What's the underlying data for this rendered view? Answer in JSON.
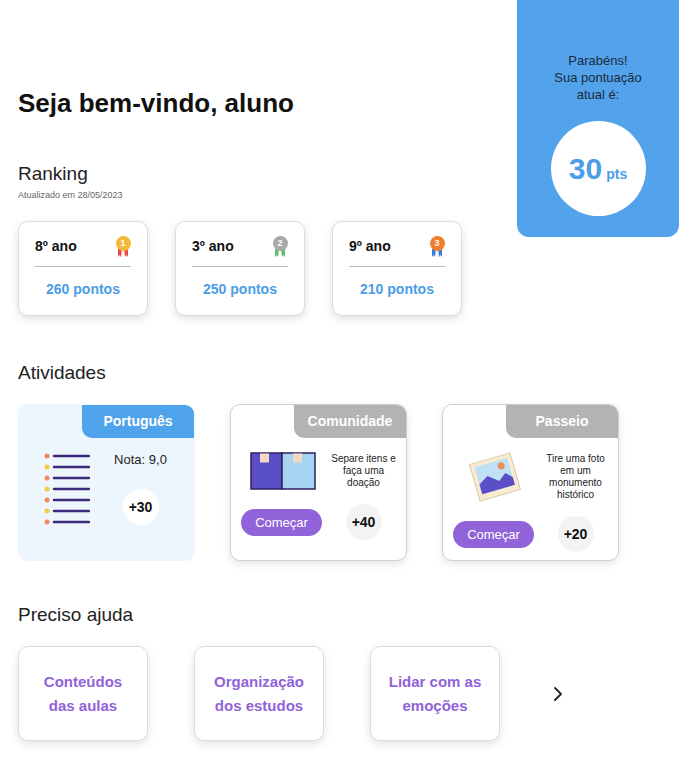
{
  "greeting": "Seja bem-vindo, aluno",
  "score_card": {
    "title": "Parabéns!",
    "subtitle": "Sua pontuação atual é:",
    "points": "30",
    "unit": "pts"
  },
  "ranking": {
    "title": "Ranking",
    "updated": "Atualizado em 28/05/2023",
    "items": [
      {
        "class": "8º ano",
        "position": "1",
        "points": "260 pontos",
        "color": "#f5b63a",
        "ribbon_color": "#e84a4a"
      },
      {
        "class": "3º ano",
        "position": "2",
        "points": "250 pontos",
        "color": "#a8a8a8",
        "ribbon_color": "#5cc06a"
      },
      {
        "class": "9º ano",
        "position": "3",
        "points": "210 pontos",
        "color": "#f07e2a",
        "ribbon_color": "#3d7fe0"
      }
    ]
  },
  "activities": {
    "title": "Atividades",
    "items": [
      {
        "kind": "grade",
        "completed": true,
        "category": "Português",
        "grade": "Nota: 9,0",
        "points": "+30"
      },
      {
        "kind": "task",
        "completed": false,
        "category": "Comunidade",
        "description": "Separe itens e faça uma doação",
        "button": "Começar",
        "points": "+40"
      },
      {
        "kind": "task",
        "completed": false,
        "category": "Passeio",
        "description": "Tire uma foto em um monumento histórico",
        "button": "Começar",
        "points": "+20"
      }
    ]
  },
  "help": {
    "title": "Preciso ajuda",
    "items": [
      "Conteúdos das aulas",
      "Organização dos estudos",
      "Lidar com as emoções"
    ]
  }
}
